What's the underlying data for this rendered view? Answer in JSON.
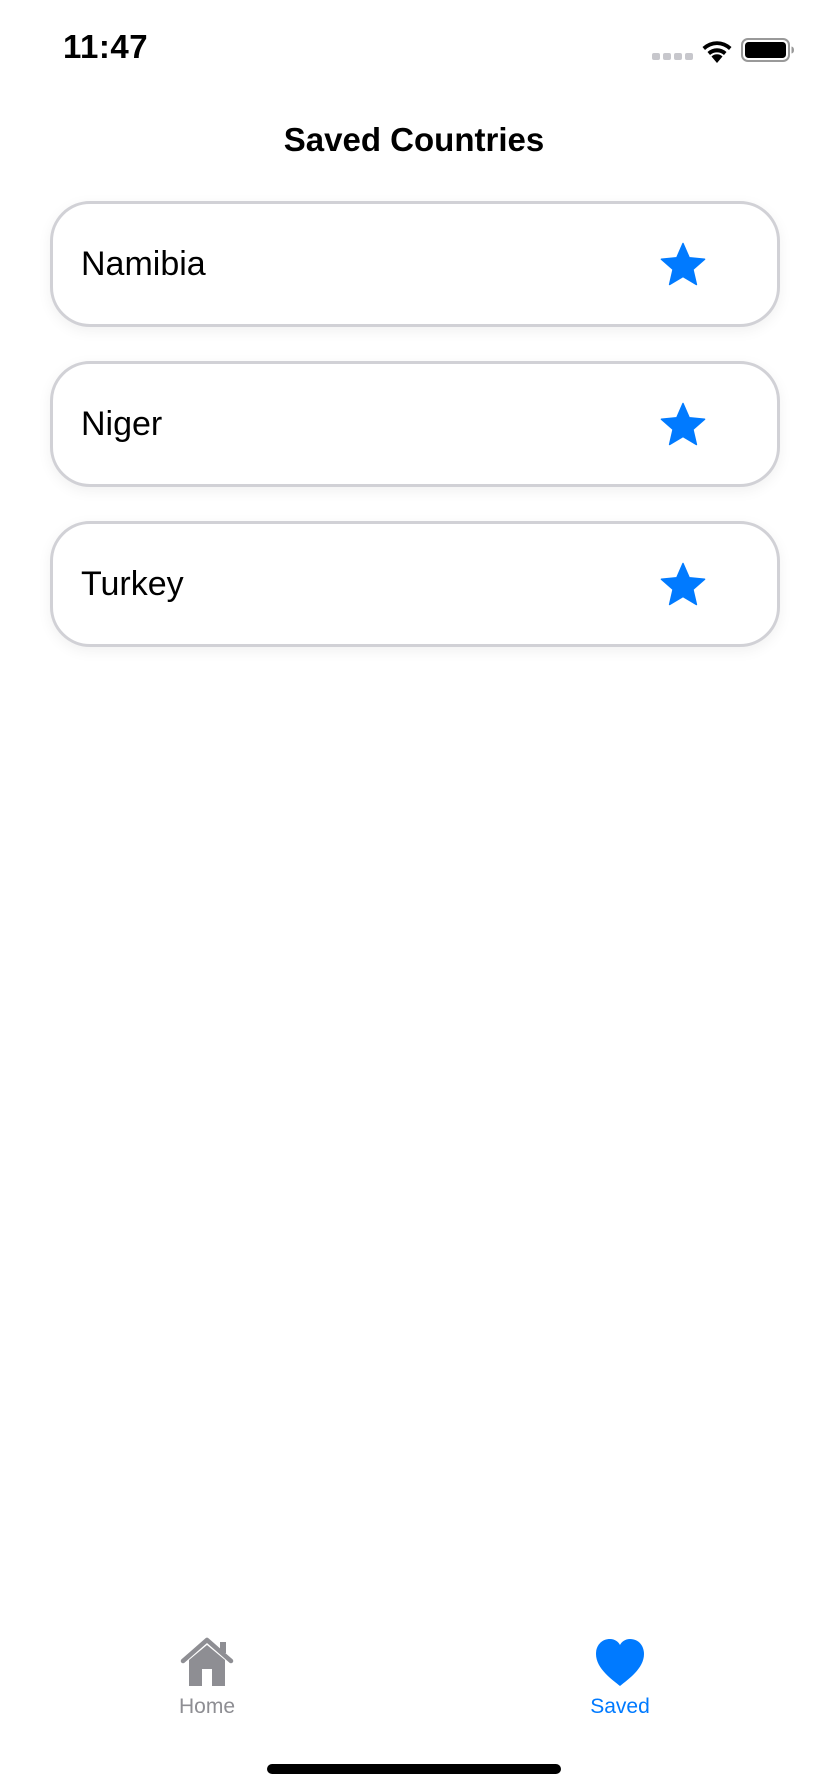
{
  "status_bar": {
    "time": "11:47"
  },
  "page": {
    "title": "Saved Countries"
  },
  "countries": [
    {
      "name": "Namibia",
      "icon": "star-icon"
    },
    {
      "name": "Niger",
      "icon": "star-icon"
    },
    {
      "name": "Turkey",
      "icon": "star-icon"
    }
  ],
  "tab_bar": {
    "tabs": [
      {
        "label": "Home",
        "icon": "house-icon",
        "active": false
      },
      {
        "label": "Saved",
        "icon": "heart-icon",
        "active": true
      }
    ]
  },
  "colors": {
    "accent": "#007aff",
    "inactive": "#8e8e93",
    "card_border": "#d1d1d6"
  }
}
